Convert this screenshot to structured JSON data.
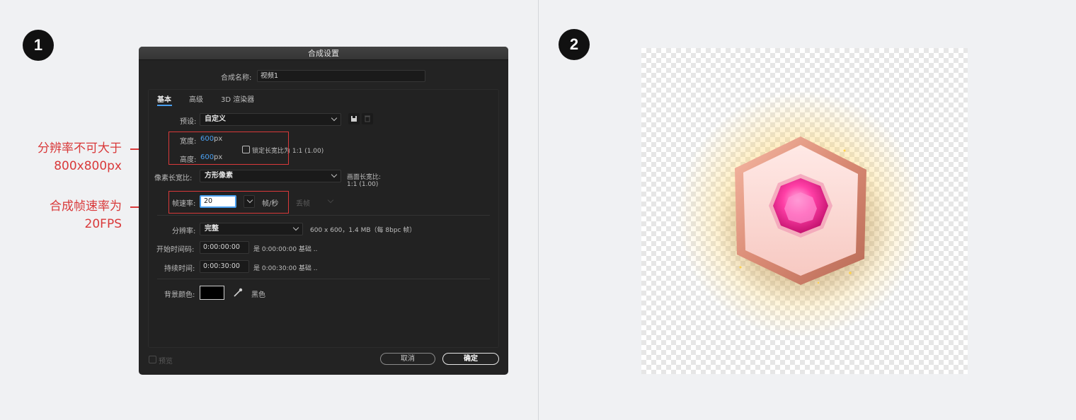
{
  "steps": [
    "1",
    "2"
  ],
  "callouts": [
    {
      "line1": "分辨率不可大于",
      "line2": "800x800px"
    },
    {
      "line1": "合成帧速率为",
      "line2": "20FPS"
    }
  ],
  "dialog": {
    "title": "合成设置",
    "name_label": "合成名称:",
    "name_value": "视频1",
    "tabs": [
      "基本",
      "高级",
      "3D 渲染器"
    ],
    "preset_label": "预设:",
    "preset_value": "自定义",
    "width_label": "宽度:",
    "width_value": "600",
    "height_label": "高度:",
    "height_value": "600",
    "unit_px": "px",
    "lock_ratio_label": "锁定长宽比为 1:1 (1.00)",
    "pixel_aspect_label": "像素长宽比:",
    "pixel_aspect_value": "方形像素",
    "frame_aspect_label": "画面长宽比:",
    "frame_aspect_value": "1:1 (1.00)",
    "fps_label": "帧速率:",
    "fps_value": "20",
    "fps_unit": "帧/秒",
    "drop_frame": "丢帧",
    "resolution_label": "分辨率:",
    "resolution_value": "完整",
    "resolution_info": "600 x 600，1.4 MB（每 8bpc 帧）",
    "start_tc_label": "开始时间码:",
    "start_tc_value": "0:00:00:00",
    "start_tc_info": "是 0:00:00:00  基础 ..",
    "duration_label": "持续时间:",
    "duration_value": "0:00:30:00",
    "duration_info": "是 0:00:30:00  基础 ..",
    "bg_color_label": "背景颜色:",
    "bg_color_name": "黑色",
    "bg_color_hex": "#000000",
    "preview_label": "预览",
    "cancel_label": "取消",
    "ok_label": "确定"
  },
  "colors": {
    "accent_red": "#d9393a",
    "accent_blue": "#4aa0f0"
  }
}
